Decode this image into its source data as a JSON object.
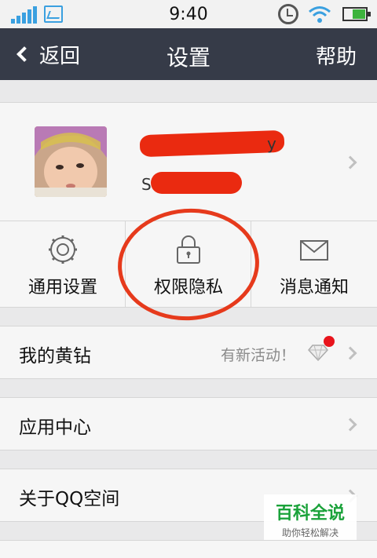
{
  "status_bar": {
    "time": "9:40"
  },
  "nav": {
    "back_label": "返回",
    "title": "设置",
    "help_label": "帮助"
  },
  "profile": {
    "name_tail": "y",
    "sub_lead": "S"
  },
  "tiles": [
    {
      "label": "通用设置",
      "icon": "gear-icon"
    },
    {
      "label": "权限隐私",
      "icon": "lock-icon"
    },
    {
      "label": "消息通知",
      "icon": "envelope-icon"
    }
  ],
  "rows": [
    {
      "label": "我的黄钻",
      "extra": "有新活动！"
    },
    {
      "label": "应用中心"
    },
    {
      "label": "关于QQ空间"
    }
  ],
  "watermark": {
    "title": "百科全说",
    "subtitle": "助你轻松解决"
  },
  "colors": {
    "nav_bg": "#363b48",
    "annotation": "#e63a1c",
    "watermark": "#1aa23a"
  }
}
